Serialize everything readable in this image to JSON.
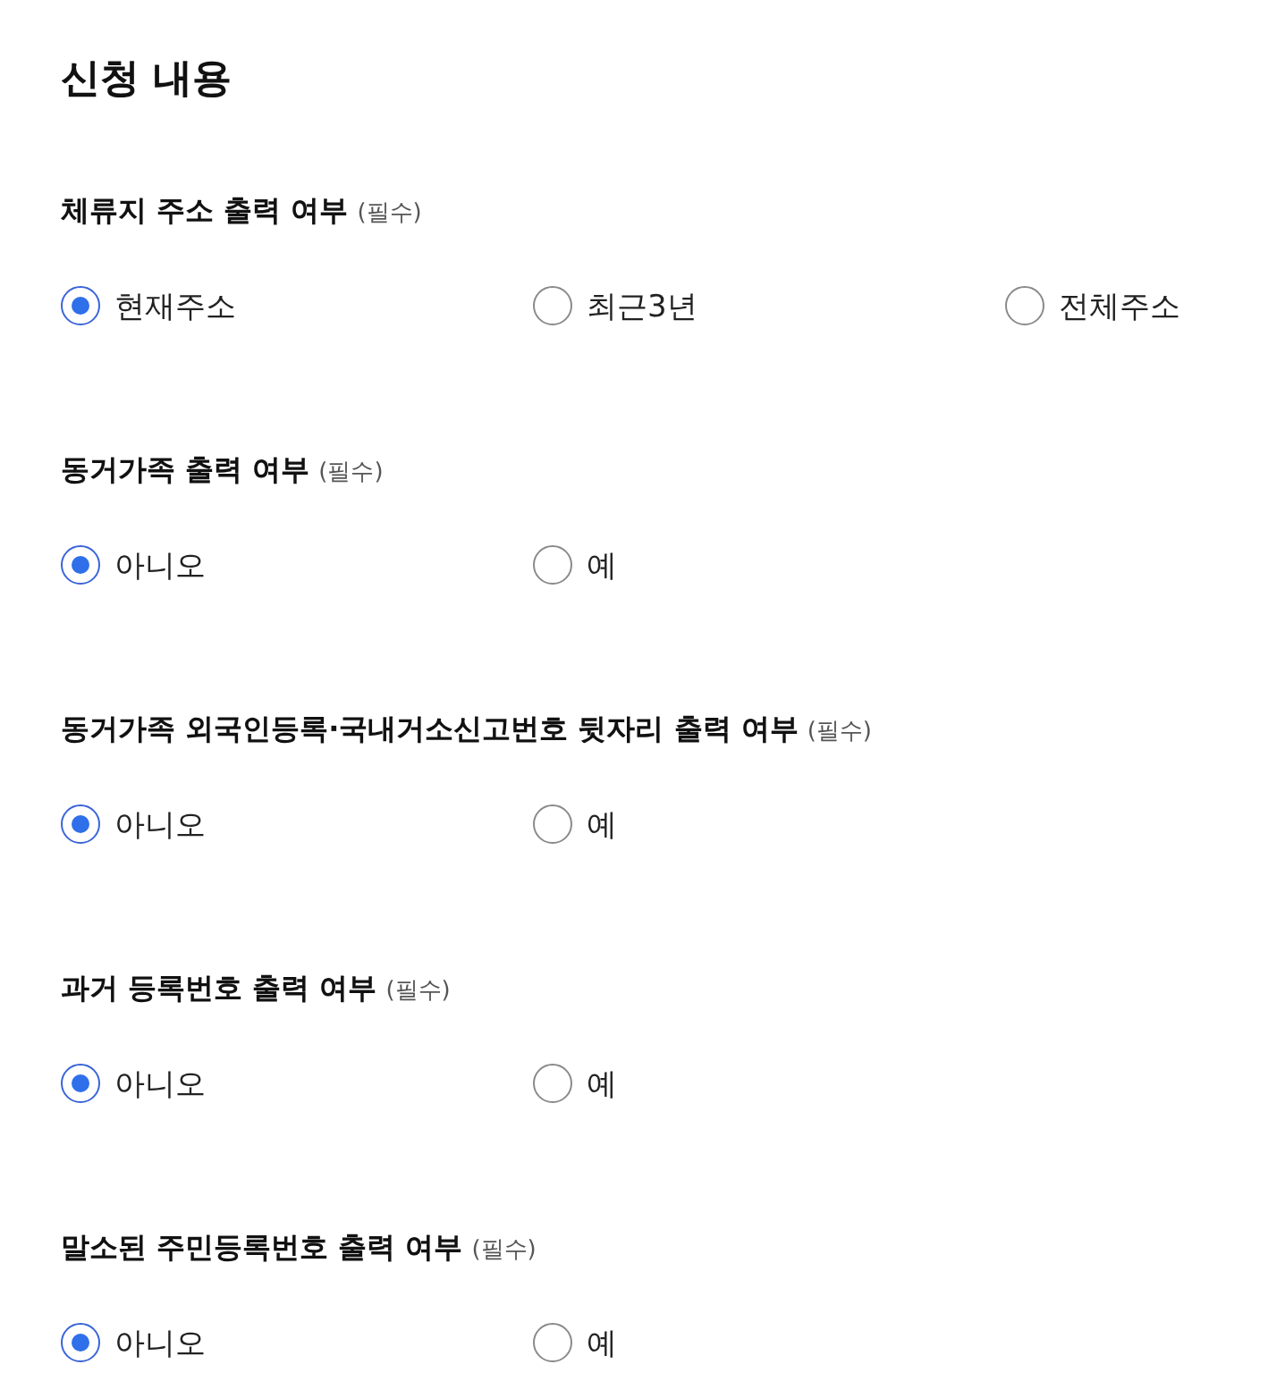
{
  "title": "신청 내용",
  "questions": [
    {
      "label": "체류지 주소 출력 여부",
      "required_note": "(필수)",
      "options": [
        {
          "label": "현재주소",
          "selected": true
        },
        {
          "label": "최근3년",
          "selected": false
        },
        {
          "label": "전체주소",
          "selected": false
        }
      ]
    },
    {
      "label": "동거가족 출력 여부",
      "required_note": "(필수)",
      "options": [
        {
          "label": "아니오",
          "selected": true
        },
        {
          "label": "예",
          "selected": false
        }
      ]
    },
    {
      "label": "동거가족 외국인등록·국내거소신고번호 뒷자리 출력 여부",
      "required_note": "(필수)",
      "options": [
        {
          "label": "아니오",
          "selected": true
        },
        {
          "label": "예",
          "selected": false
        }
      ]
    },
    {
      "label": "과거 등록번호 출력 여부",
      "required_note": "(필수)",
      "options": [
        {
          "label": "아니오",
          "selected": true
        },
        {
          "label": "예",
          "selected": false
        }
      ]
    },
    {
      "label": "말소된 주민등록번호 출력 여부",
      "required_note": "(필수)",
      "options": [
        {
          "label": "아니오",
          "selected": true
        },
        {
          "label": "예",
          "selected": false
        }
      ]
    }
  ]
}
